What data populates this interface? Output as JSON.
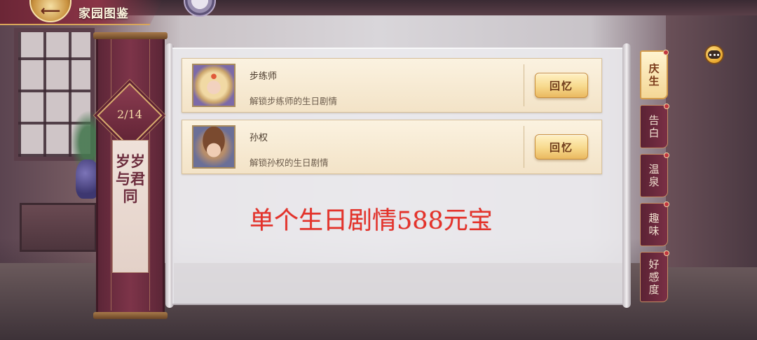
{
  "header": {
    "back_icon": "back-arrow-icon",
    "title": "家园图鉴"
  },
  "banner": {
    "page_counter": "2/14",
    "title": "岁岁与君同"
  },
  "cards": [
    {
      "avatar_icon": "character-portrait-icon",
      "name": "步练师",
      "description": "解锁步练师的生日剧情",
      "button_label": "回忆"
    },
    {
      "avatar_icon": "character-portrait-icon",
      "name": "孙权",
      "description": "解锁孙权的生日剧情",
      "button_label": "回忆"
    }
  ],
  "overlay_note": "单个生日剧情588元宝",
  "tabs": [
    {
      "label": "庆生",
      "active": true
    },
    {
      "label": "告白",
      "active": false
    },
    {
      "label": "温泉",
      "active": false
    },
    {
      "label": "趣味",
      "active": false
    },
    {
      "label": "好感度",
      "active": false
    }
  ],
  "chat": {
    "icon": "chat-bubble-icon"
  },
  "colors": {
    "accent_red": "#e5322a",
    "button_gold": "#f7d98c",
    "tab_maroon": "#7a2f45"
  }
}
